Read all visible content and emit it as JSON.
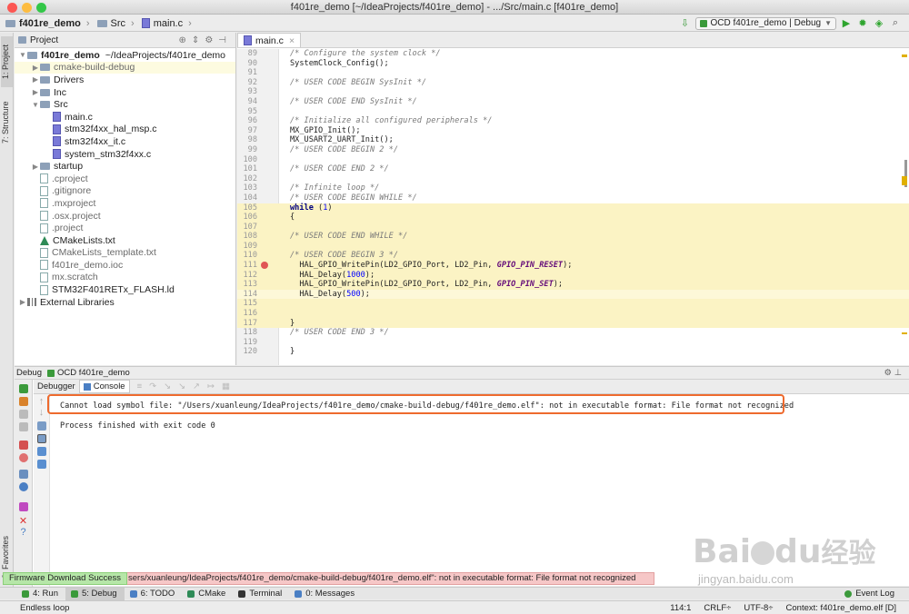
{
  "window": {
    "title": "f401re_demo [~/IdeaProjects/f401re_demo] - .../Src/main.c [f401re_demo]"
  },
  "nav": {
    "crumbs": [
      "f401re_demo",
      "Src",
      "main.c"
    ],
    "run_config": "OCD f401re_demo | Debug"
  },
  "side_tabs": {
    "project": "1: Project",
    "structure": "7: Structure",
    "favorites": "2: Favorites"
  },
  "project": {
    "header": "Project",
    "tree": [
      {
        "label": "f401re_demo",
        "suffix": "~/IdeaProjects/f401re_demo",
        "depth": 0,
        "arrow": "▼",
        "icon": "folder-icon",
        "bold": true
      },
      {
        "label": "cmake-build-debug",
        "depth": 1,
        "arrow": "▶",
        "icon": "folder-icon",
        "muted": true,
        "selected": true
      },
      {
        "label": "Drivers",
        "depth": 1,
        "arrow": "▶",
        "icon": "folder-icon"
      },
      {
        "label": "Inc",
        "depth": 1,
        "arrow": "▶",
        "icon": "folder-icon"
      },
      {
        "label": "Src",
        "depth": 1,
        "arrow": "▼",
        "icon": "folder-icon"
      },
      {
        "label": "main.c",
        "depth": 2,
        "arrow": "",
        "icon": "c-file-icon"
      },
      {
        "label": "stm32f4xx_hal_msp.c",
        "depth": 2,
        "arrow": "",
        "icon": "c-file-icon"
      },
      {
        "label": "stm32f4xx_it.c",
        "depth": 2,
        "arrow": "",
        "icon": "c-file-icon"
      },
      {
        "label": "system_stm32f4xx.c",
        "depth": 2,
        "arrow": "",
        "icon": "c-file-icon"
      },
      {
        "label": "startup",
        "depth": 1,
        "arrow": "▶",
        "icon": "folder-icon"
      },
      {
        "label": ".cproject",
        "depth": 1,
        "arrow": "",
        "icon": "file-icon",
        "muted": true
      },
      {
        "label": ".gitignore",
        "depth": 1,
        "arrow": "",
        "icon": "file-icon",
        "muted": true
      },
      {
        "label": ".mxproject",
        "depth": 1,
        "arrow": "",
        "icon": "file-icon",
        "muted": true
      },
      {
        "label": ".osx.project",
        "depth": 1,
        "arrow": "",
        "icon": "file-icon",
        "muted": true
      },
      {
        "label": ".project",
        "depth": 1,
        "arrow": "",
        "icon": "file-icon",
        "muted": true
      },
      {
        "label": "CMakeLists.txt",
        "depth": 1,
        "arrow": "",
        "icon": "cmake-icon"
      },
      {
        "label": "CMakeLists_template.txt",
        "depth": 1,
        "arrow": "",
        "icon": "file-icon",
        "muted": true
      },
      {
        "label": "f401re_demo.ioc",
        "depth": 1,
        "arrow": "",
        "icon": "file-icon",
        "muted": true
      },
      {
        "label": "mx.scratch",
        "depth": 1,
        "arrow": "",
        "icon": "file-icon",
        "muted": true
      },
      {
        "label": "STM32F401RETx_FLASH.ld",
        "depth": 1,
        "arrow": "",
        "icon": "file-icon"
      },
      {
        "label": "External Libraries",
        "depth": 0,
        "arrow": "▶",
        "icon": "library-icon"
      }
    ]
  },
  "editor": {
    "tab": "main.c",
    "lines": [
      {
        "n": "89",
        "html": "<span class=\"comment\">/* Configure the system clock */</span>"
      },
      {
        "n": "90",
        "html": "SystemClock_Config();"
      },
      {
        "n": "91",
        "html": ""
      },
      {
        "n": "92",
        "html": "<span class=\"comment\">/* USER CODE BEGIN SysInit */</span>"
      },
      {
        "n": "93",
        "html": ""
      },
      {
        "n": "94",
        "html": "<span class=\"comment\">/* USER CODE END SysInit */</span>"
      },
      {
        "n": "95",
        "html": ""
      },
      {
        "n": "96",
        "html": "<span class=\"comment\">/* Initialize all configured peripherals */</span>"
      },
      {
        "n": "97",
        "html": "MX_GPIO_Init();"
      },
      {
        "n": "98",
        "html": "MX_USART2_UART_Init();"
      },
      {
        "n": "99",
        "html": "<span class=\"comment\">/* USER CODE BEGIN 2 */</span>"
      },
      {
        "n": "100",
        "html": ""
      },
      {
        "n": "101",
        "html": "<span class=\"comment\">/* USER CODE END 2 */</span>"
      },
      {
        "n": "102",
        "html": ""
      },
      {
        "n": "103",
        "html": "<span class=\"comment\">/* Infinite loop */</span>"
      },
      {
        "n": "104",
        "html": "<span class=\"comment\">/* USER CODE BEGIN WHILE */</span>"
      },
      {
        "n": "105",
        "html": "<span class=\"kw\">while</span> (<span class=\"num\">1</span>)",
        "hl": true
      },
      {
        "n": "106",
        "html": "{",
        "hl": true
      },
      {
        "n": "107",
        "html": "",
        "hl": true
      },
      {
        "n": "108",
        "html": "<span class=\"comment\">/* USER CODE END WHILE */</span>",
        "hl": true
      },
      {
        "n": "109",
        "html": "",
        "hl": true
      },
      {
        "n": "110",
        "html": "<span class=\"comment\">/* USER CODE BEGIN 3 */</span>",
        "hl": true
      },
      {
        "n": "111",
        "html": "  HAL_GPIO_WritePin(LD2_GPIO_Port, LD2_Pin, <span class=\"macro\">GPIO_PIN_RESET</span>);",
        "hl": true,
        "bp": true
      },
      {
        "n": "112",
        "html": "  HAL_Delay(<span class=\"num\">1000</span>);",
        "hl": true
      },
      {
        "n": "113",
        "html": "  HAL_GPIO_WritePin(LD2_GPIO_Port, LD2_Pin, <span class=\"macro\">GPIO_PIN_SET</span>);",
        "hl": true
      },
      {
        "n": "114",
        "html": "  HAL_Delay(<span class=\"num\">500</span>);",
        "hl": true,
        "cur": true
      },
      {
        "n": "115",
        "html": "",
        "hl": true
      },
      {
        "n": "116",
        "html": "",
        "hl": true
      },
      {
        "n": "117",
        "html": "}",
        "hl": true
      },
      {
        "n": "118",
        "html": "<span class=\"comment\">/* USER CODE END 3 */</span>"
      },
      {
        "n": "119",
        "html": ""
      },
      {
        "n": "120",
        "html": "}"
      }
    ]
  },
  "debug": {
    "header": "Debug",
    "config": "OCD f401re_demo",
    "tabs": [
      "Debugger",
      "Console"
    ],
    "console": [
      "Cannot load symbol file: \"/Users/xuanleung/IdeaProjects/f401re_demo/cmake-build-debug/f401re_demo.elf\": not in executable format: File format not recognized",
      "",
      "Process finished with exit code 0"
    ]
  },
  "balloons": {
    "success": "Firmware Download Success",
    "error": "sers/xuanleung/IdeaProjects/f401re_demo/cmake-build-debug/f401re_demo.elf\": not in executable format: File format not recognized"
  },
  "tool_windows": [
    {
      "label": "4: Run",
      "color": "#3b9a3b",
      "icon": "run-icon"
    },
    {
      "label": "5: Debug",
      "color": "#3b9a3b",
      "icon": "bug-icon",
      "active": true
    },
    {
      "label": "6: TODO",
      "color": "#4a7fc4",
      "icon": "todo-icon"
    },
    {
      "label": "CMake",
      "color": "#2e8b57",
      "icon": "cmake-icon"
    },
    {
      "label": "Terminal",
      "color": "#333333",
      "icon": "terminal-icon"
    },
    {
      "label": "0: Messages",
      "color": "#4a7fc4",
      "icon": "messages-icon"
    }
  ],
  "event_log": "Event Log",
  "status": {
    "left": "Endless loop",
    "position": "114:1",
    "line_sep": "CRLF÷",
    "encoding": "UTF-8÷",
    "context": "Context: f401re_demo.elf [D]"
  },
  "watermark": {
    "logo": "Bai",
    "logo2": "du",
    "cn": "经验",
    "url": "jingyan.baidu.com"
  },
  "colors": {
    "accent_green": "#3b9a3b",
    "highlight_box": "#ee6a2e",
    "loop_highlight": "#fbf3c4"
  }
}
